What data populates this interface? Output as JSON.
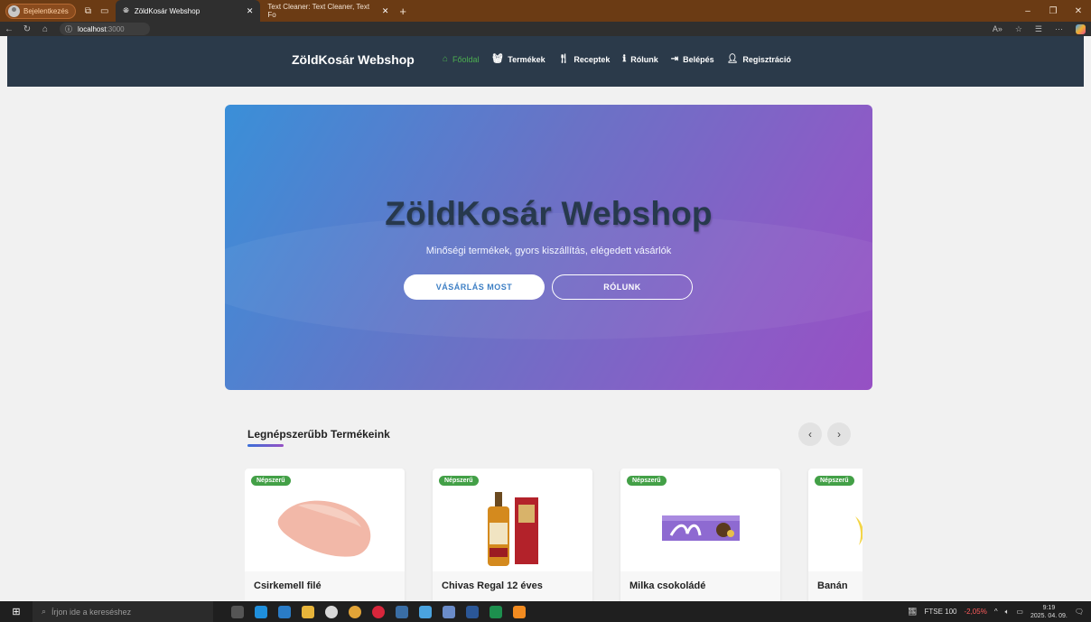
{
  "browser": {
    "profile_label": "Bejelentkezés",
    "tabs": [
      {
        "title": "ZöldKosár Webshop",
        "active": true
      },
      {
        "title": "Text Cleaner: Text Cleaner, Text Fo",
        "active": false
      }
    ],
    "url_host": "localhost",
    "url_port": ":3000"
  },
  "site": {
    "brand": "ZöldKosár Webshop",
    "menu": [
      {
        "label": "Főoldal",
        "icon": "home-icon",
        "active": true
      },
      {
        "label": "Termékek",
        "icon": "basket-icon",
        "active": false
      },
      {
        "label": "Receptek",
        "icon": "utensils-icon",
        "active": false
      },
      {
        "label": "Rólunk",
        "icon": "info-icon",
        "active": false
      },
      {
        "label": "Belépés",
        "icon": "login-icon",
        "active": false
      },
      {
        "label": "Regisztráció",
        "icon": "user-plus-icon",
        "active": false
      }
    ],
    "accent_color": "#4caf50"
  },
  "hero": {
    "title": "ZöldKosár Webshop",
    "subtitle": "Minőségi termékek, gyors kiszállítás, elégedett vásárlók",
    "primary_button": "VÁSÁRLÁS MOST",
    "secondary_button": "RÓLUNK"
  },
  "popular": {
    "title": "Legnépszerűbb Termékeink",
    "products": [
      {
        "name": "Csirkemell filé",
        "badge": "Népszerű"
      },
      {
        "name": "Chivas Regal 12 éves",
        "badge": "Népszerű"
      },
      {
        "name": "Milka csokoládé",
        "badge": "Népszerű"
      },
      {
        "name": "Banán",
        "badge": "Népszerű"
      }
    ]
  },
  "taskbar": {
    "search_placeholder": "Írjon ide a kereséshez",
    "ticker_name": "FTSE 100",
    "ticker_change": "-2,05%",
    "time": "9:19",
    "date": "2025. 04. 09."
  }
}
